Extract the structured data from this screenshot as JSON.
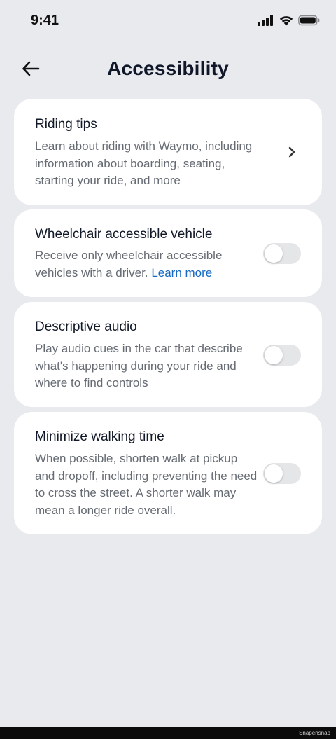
{
  "status_bar": {
    "time": "9:41",
    "icons": [
      "signal-icon",
      "wifi-icon",
      "battery-icon"
    ]
  },
  "header": {
    "title": "Accessibility",
    "back_icon": "arrow-left-icon"
  },
  "cards": [
    {
      "title": "Riding tips",
      "description": "Learn about riding with Waymo, including information about boarding, seating, starting your ride, and more",
      "control": "chevron-right-icon"
    },
    {
      "title": "Wheelchair accessible vehicle",
      "description": "Receive only wheelchair accessible vehicles with a driver.",
      "link": "Learn more",
      "control": "toggle",
      "enabled": false
    },
    {
      "title": "Descriptive audio",
      "description": "Play audio cues in the car that describe what's happening during your ride and where to find controls",
      "control": "toggle",
      "enabled": false
    },
    {
      "title": "Minimize walking time",
      "description": "When possible, shorten walk at pickup and dropoff, including preventing the need to cross the street. A shorter walk may mean a longer ride overall.",
      "control": "toggle",
      "enabled": false
    }
  ],
  "watermark": "Snapensnap",
  "colors": {
    "background": "#e8eaee",
    "card": "#ffffff",
    "link": "#1769c4",
    "toggle_off": "#e5e6e8"
  }
}
